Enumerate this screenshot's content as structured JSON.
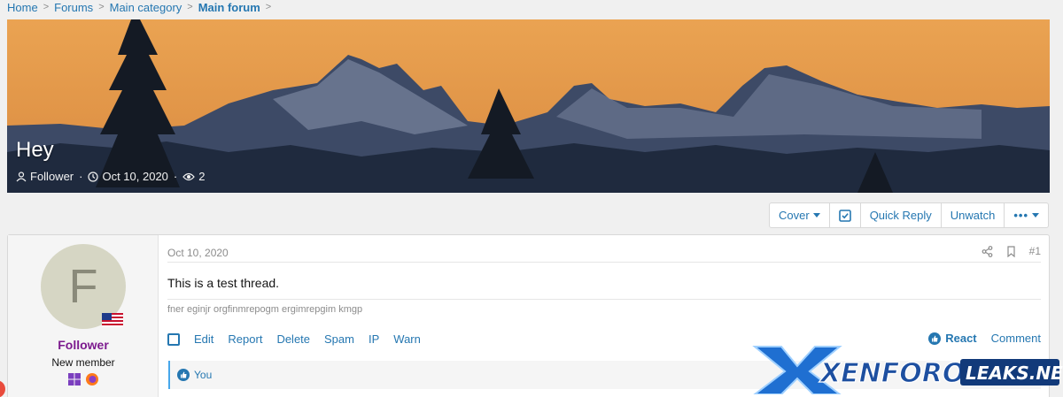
{
  "breadcrumb": [
    "Home",
    "Forums",
    "Main category",
    "Main forum"
  ],
  "thread": {
    "title": "Hey",
    "author": "Follower",
    "date": "Oct 10, 2020",
    "views": "2"
  },
  "toolbar": {
    "cover": "Cover",
    "quick_reply": "Quick Reply",
    "unwatch": "Unwatch"
  },
  "post": {
    "user": {
      "avatar_letter": "F",
      "name": "Follower",
      "title": "New member"
    },
    "date": "Oct 10, 2020",
    "number": "#1",
    "body": "This is a test thread.",
    "signature": "fner eginjr orgfinmrepogm ergimrepgim kmgp",
    "actions": [
      "Edit",
      "Report",
      "Delete",
      "Spam",
      "IP",
      "Warn"
    ],
    "react": "React",
    "comment": "Comment",
    "reactions_text": "You"
  },
  "watermark": {
    "brand": "XENFORO",
    "suffix": "LEAKS.NET"
  },
  "colors": {
    "link": "#2577b1",
    "username": "#7c1a8e",
    "sky_top": "#e8a050",
    "sky_bottom": "#d87a30"
  }
}
